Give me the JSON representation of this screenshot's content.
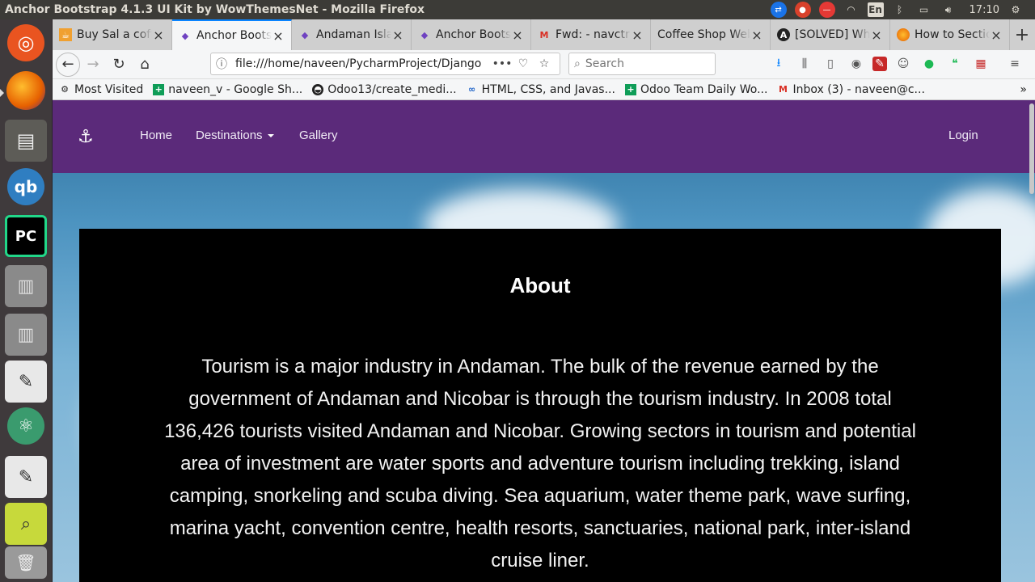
{
  "os": {
    "window_title": "Anchor Bootstrap 4.1.3 UI Kit by WowThemesNet - Mozilla Firefox",
    "clock": "17:10",
    "keyboard_layout": "En"
  },
  "launcher": {
    "items": [
      "ubuntu-dash-icon",
      "firefox-icon",
      "files-icon",
      "qbittorrent-icon",
      "pycharm-icon",
      "drive-icon",
      "drive-icon",
      "text-editor-icon",
      "atom-icon",
      "text-editor-icon",
      "search-tool-icon",
      "trash-icon"
    ]
  },
  "browser": {
    "tabs": [
      {
        "label": "Buy Sal a coffee",
        "favicon": "cup-icon",
        "active": false
      },
      {
        "label": "Anchor Bootstrap",
        "favicon": "cube-icon",
        "active": true
      },
      {
        "label": "Andaman Island",
        "favicon": "cube-icon",
        "active": false
      },
      {
        "label": "Anchor Bootstrap",
        "favicon": "cube-icon",
        "active": false
      },
      {
        "label": "Fwd: - navctr",
        "favicon": "gmail-icon",
        "active": false
      },
      {
        "label": "Coffee Shop Web",
        "favicon": "",
        "active": false
      },
      {
        "label": "[SOLVED] Why",
        "favicon": "a-icon",
        "active": false
      },
      {
        "label": "How to Section",
        "favicon": "firefox-icon",
        "active": false
      }
    ],
    "url": "file:///home/naveen/PycharmProject/Django",
    "search_placeholder": "Search",
    "bookmarks": [
      {
        "label": "Most Visited",
        "icon": "gear-icon"
      },
      {
        "label": "naveen_v - Google Sh...",
        "icon": "sheets-icon"
      },
      {
        "label": "Odoo13/create_medi...",
        "icon": "github-icon"
      },
      {
        "label": "HTML, CSS, and Javas...",
        "icon": "link-icon"
      },
      {
        "label": "Odoo Team Daily Wo...",
        "icon": "sheets-icon"
      },
      {
        "label": "Inbox (3) - naveen@c...",
        "icon": "gmail-icon"
      }
    ]
  },
  "site": {
    "nav": {
      "home": "Home",
      "destinations": "Destinations",
      "gallery": "Gallery",
      "login": "Login"
    },
    "about": {
      "title": "About",
      "body": "Tourism is a major industry in Andaman. The bulk of the revenue earned by the government of Andaman and Nicobar is through the tourism industry. In 2008 total 136,426 tourists visited Andaman and Nicobar. Growing sectors in tourism and potential area of investment are water sports and adventure tourism including trekking, island camping, snorkeling and scuba diving. Sea aquarium, water theme park, wave surfing, marina yacht, convention centre, health resorts, sanctuaries, national park, inter-island cruise liner."
    }
  },
  "colors": {
    "site_nav": "#5b2a7a",
    "tab_accent": "#0a84ff",
    "about_bg": "#000000"
  }
}
